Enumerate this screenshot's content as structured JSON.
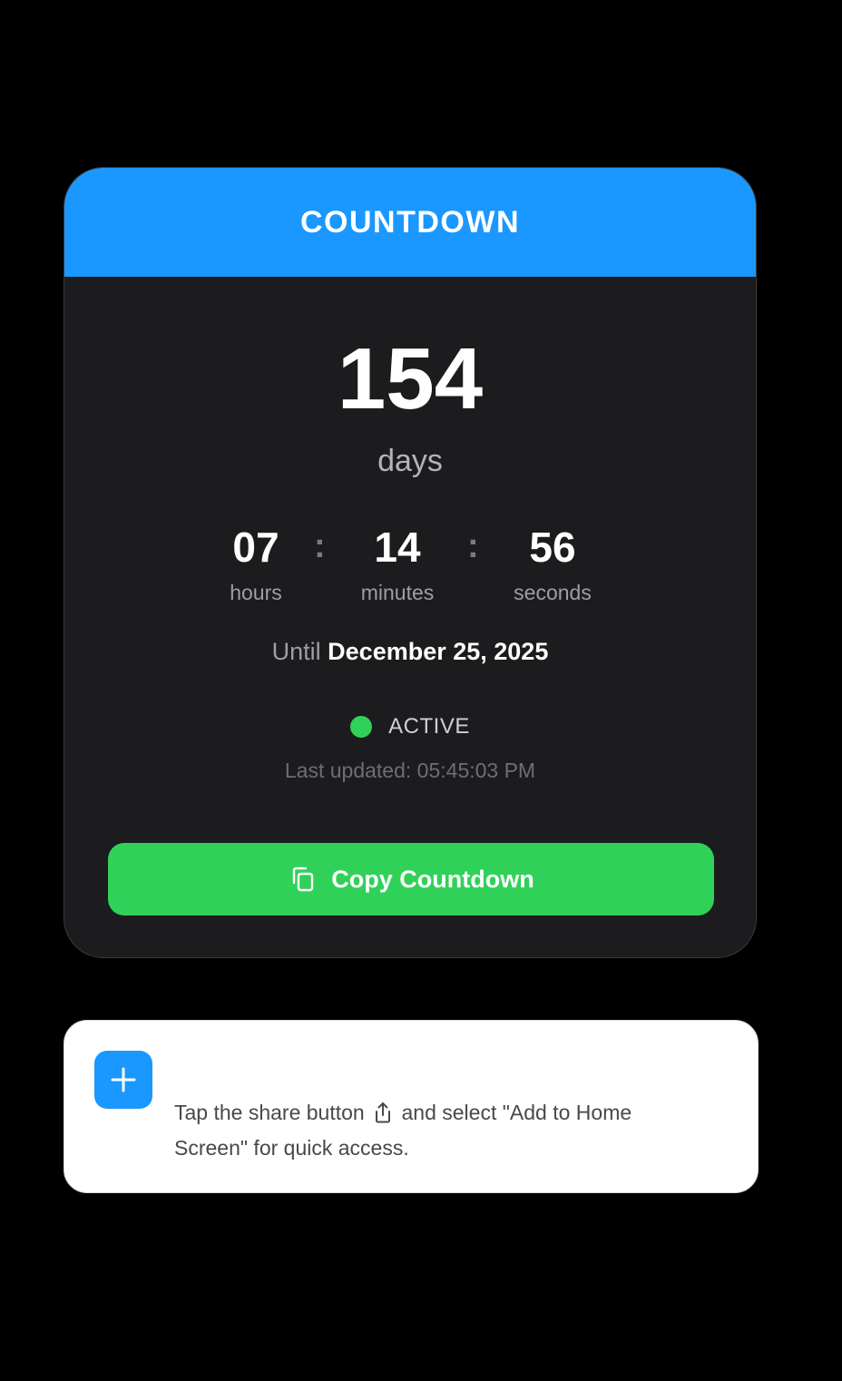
{
  "header": {
    "title": "COUNTDOWN"
  },
  "countdown": {
    "days": "154",
    "days_label": "days",
    "hours": "07",
    "hours_label": "hours",
    "minutes": "14",
    "minutes_label": "minutes",
    "seconds": "56",
    "seconds_label": "seconds",
    "separator": ":"
  },
  "target": {
    "prefix": "Until",
    "date": "December 25, 2025"
  },
  "status": {
    "label": "ACTIVE",
    "color": "#30d158",
    "last_updated": "Last updated: 05:45:03 PM"
  },
  "actions": {
    "copy_label": "Copy Countdown",
    "copy_icon": "copy-icon"
  },
  "hint": {
    "icon": "plus-icon",
    "text_before": "Tap the share button",
    "share_icon": "share-icon",
    "text_after": "and select \"Add to Home Screen\" for quick access."
  },
  "colors": {
    "accent": "#1a98ff",
    "success": "#30d158",
    "card_bg": "#1c1c1e"
  }
}
